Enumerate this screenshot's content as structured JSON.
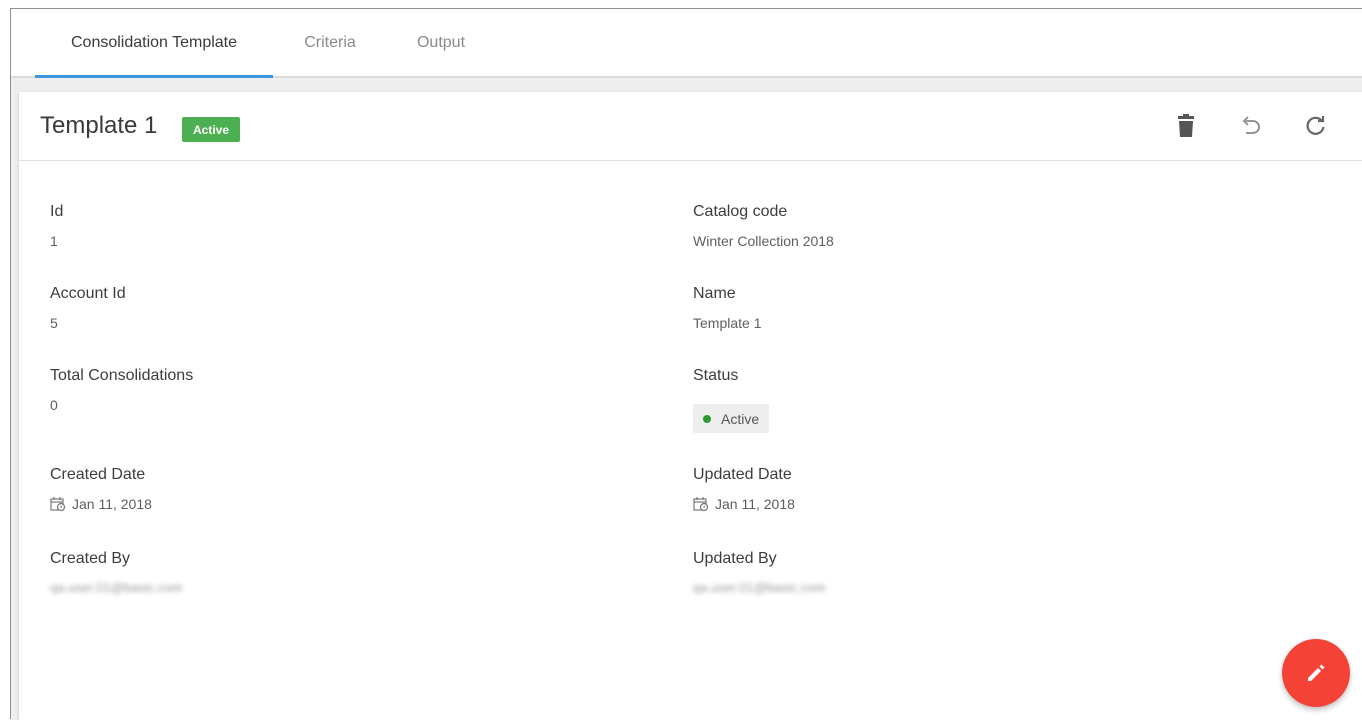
{
  "tabs": [
    {
      "label": "Consolidation Template",
      "active": true
    },
    {
      "label": "Criteria",
      "active": false
    },
    {
      "label": "Output",
      "active": false
    }
  ],
  "header": {
    "title": "Template 1",
    "status_badge": "Active",
    "icons": [
      "delete-icon",
      "undo-icon",
      "refresh-icon"
    ]
  },
  "fields": {
    "id": {
      "label": "Id",
      "value": "1"
    },
    "catalog_code": {
      "label": "Catalog code",
      "value": "Winter Collection 2018"
    },
    "account_id": {
      "label": "Account Id",
      "value": "5"
    },
    "name": {
      "label": "Name",
      "value": "Template 1"
    },
    "total_consolidations": {
      "label": "Total Consolidations",
      "value": "0"
    },
    "status": {
      "label": "Status",
      "value": "Active"
    },
    "created_date": {
      "label": "Created Date",
      "value": "Jan 11, 2018"
    },
    "updated_date": {
      "label": "Updated Date",
      "value": "Jan 11, 2018"
    },
    "created_by": {
      "label": "Created By",
      "value": "qa.user.01@basic.com"
    },
    "updated_by": {
      "label": "Updated By",
      "value": "qa.user.01@basic.com"
    }
  },
  "fab": {
    "icon": "edit-icon"
  },
  "colors": {
    "accent": "#3a96dd",
    "badge_active": "#4caf50",
    "status_dot": "#2e9b2e",
    "fab": "#f44336"
  }
}
